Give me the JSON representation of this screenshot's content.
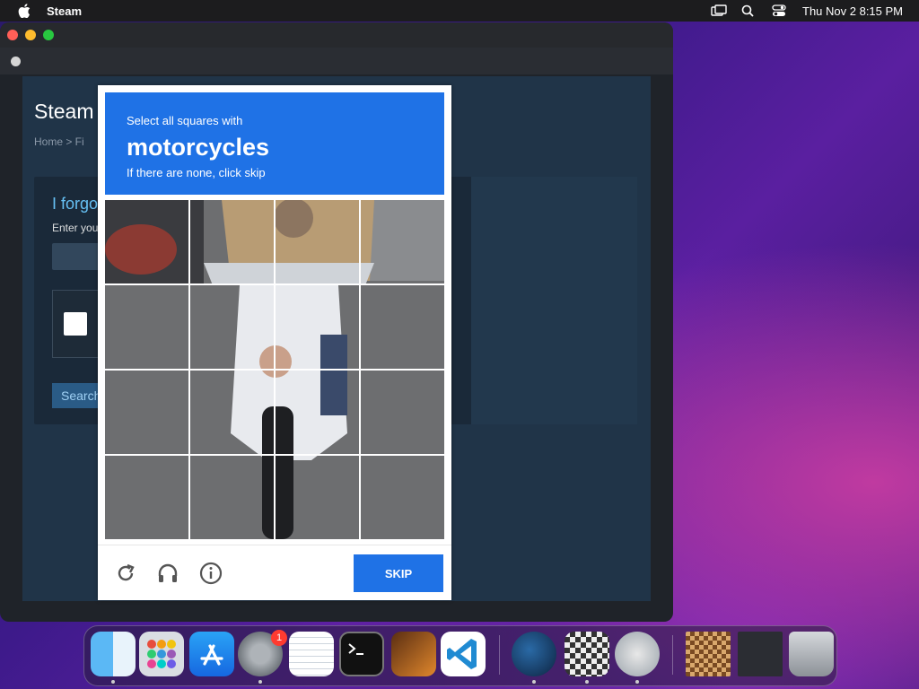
{
  "menubar": {
    "app_name": "Steam",
    "datetime": "Thu Nov 2  8:15 PM",
    "icons": [
      "apple-icon",
      "display-icon",
      "search-icon",
      "control-center-icon"
    ]
  },
  "steam_page": {
    "title": "Steam",
    "breadcrumb": "Home > Fi",
    "heading": "I forgo",
    "instruction": "Enter you",
    "search_button": "Search"
  },
  "captcha": {
    "line1": "Select all squares with",
    "target": "motorcycles",
    "line3": "If there are none, click skip",
    "skip_label": "SKIP",
    "footer_icons": [
      "refresh-icon",
      "audio-icon",
      "info-icon"
    ],
    "accent_color": "#1f72e6"
  },
  "dock": {
    "items": [
      "Finder",
      "Launchpad",
      "App Store",
      "System Preferences",
      "TextEdit",
      "Terminal",
      "GarageBand",
      "Visual Studio Code",
      "Steam",
      "Chess",
      "Automator",
      "Chess Window",
      "Desktop Window",
      "Trash"
    ],
    "system_preferences_badge": "1"
  },
  "colors": {
    "window_bg": "#1f2329",
    "steam_bg": "#203448",
    "steam_link": "#66c0f4",
    "close": "#ff5f57",
    "minimize": "#febc2e",
    "zoom": "#28c840"
  }
}
